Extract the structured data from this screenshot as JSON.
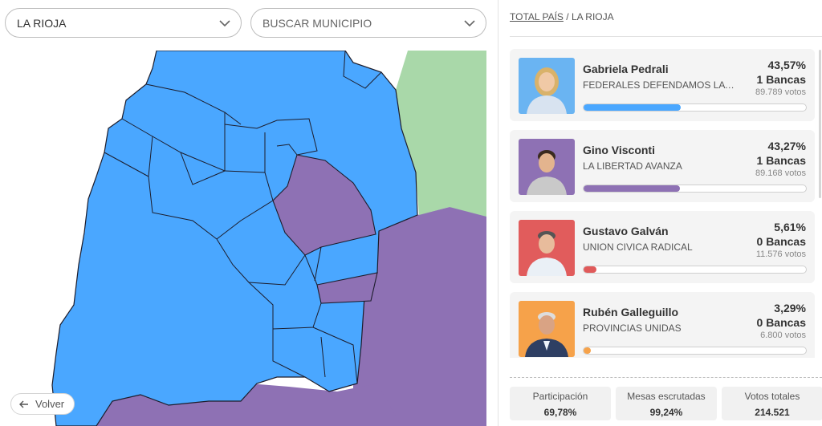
{
  "selectors": {
    "province": {
      "value": "LA RIOJA",
      "icon": "chevron-down-icon"
    },
    "municipality": {
      "placeholder": "BUSCAR MUNICIPIO",
      "icon": "chevron-down-icon"
    }
  },
  "map": {
    "back_label": "Volver",
    "back_icon": "arrow-left-icon",
    "colors": {
      "blue": "#4aa7ff",
      "purple": "#8e71b4",
      "green": "#a9d8a9",
      "border": "#1c1c2b"
    }
  },
  "breadcrumb": {
    "root": "TOTAL PAÍS",
    "separator": "/",
    "current": "LA RIOJA"
  },
  "candidates": [
    {
      "name": "Gabriela Pedrali",
      "party": "FEDERALES DEFENDAMOS LA RIOJA",
      "percent": "43,57%",
      "seats": "1 Bancas",
      "votes": "89.789 votos",
      "share": 0.4357,
      "color": "#4aa7ff",
      "photo_bg": "#6ab4f2",
      "shirt": "#d8e3f0"
    },
    {
      "name": "Gino Visconti",
      "party": "LA LIBERTAD AVANZA",
      "percent": "43,27%",
      "seats": "1 Bancas",
      "votes": "89.168 votos",
      "share": 0.4327,
      "color": "#8e71b4",
      "photo_bg": "#8e71b4",
      "shirt": "#c9c9c9"
    },
    {
      "name": "Gustavo Galván",
      "party": "UNION CIVICA RADICAL",
      "percent": "5,61%",
      "seats": "0 Bancas",
      "votes": "11.576 votos",
      "share": 0.0561,
      "color": "#e05a5a",
      "photo_bg": "#e15c5c",
      "shirt": "#eaf0f6"
    },
    {
      "name": "Rubén Galleguillo",
      "party": "PROVINCIAS UNIDAS",
      "percent": "3,29%",
      "seats": "0 Bancas",
      "votes": "6.800 votos",
      "share": 0.0329,
      "color": "#f6a24a",
      "photo_bg": "#f6a24a",
      "shirt": "#2e3f63"
    }
  ],
  "stats": [
    {
      "label": "Participación",
      "value": "69,78%"
    },
    {
      "label": "Mesas escrutadas",
      "value": "99,24%"
    },
    {
      "label": "Votos totales",
      "value": "214.521"
    }
  ]
}
